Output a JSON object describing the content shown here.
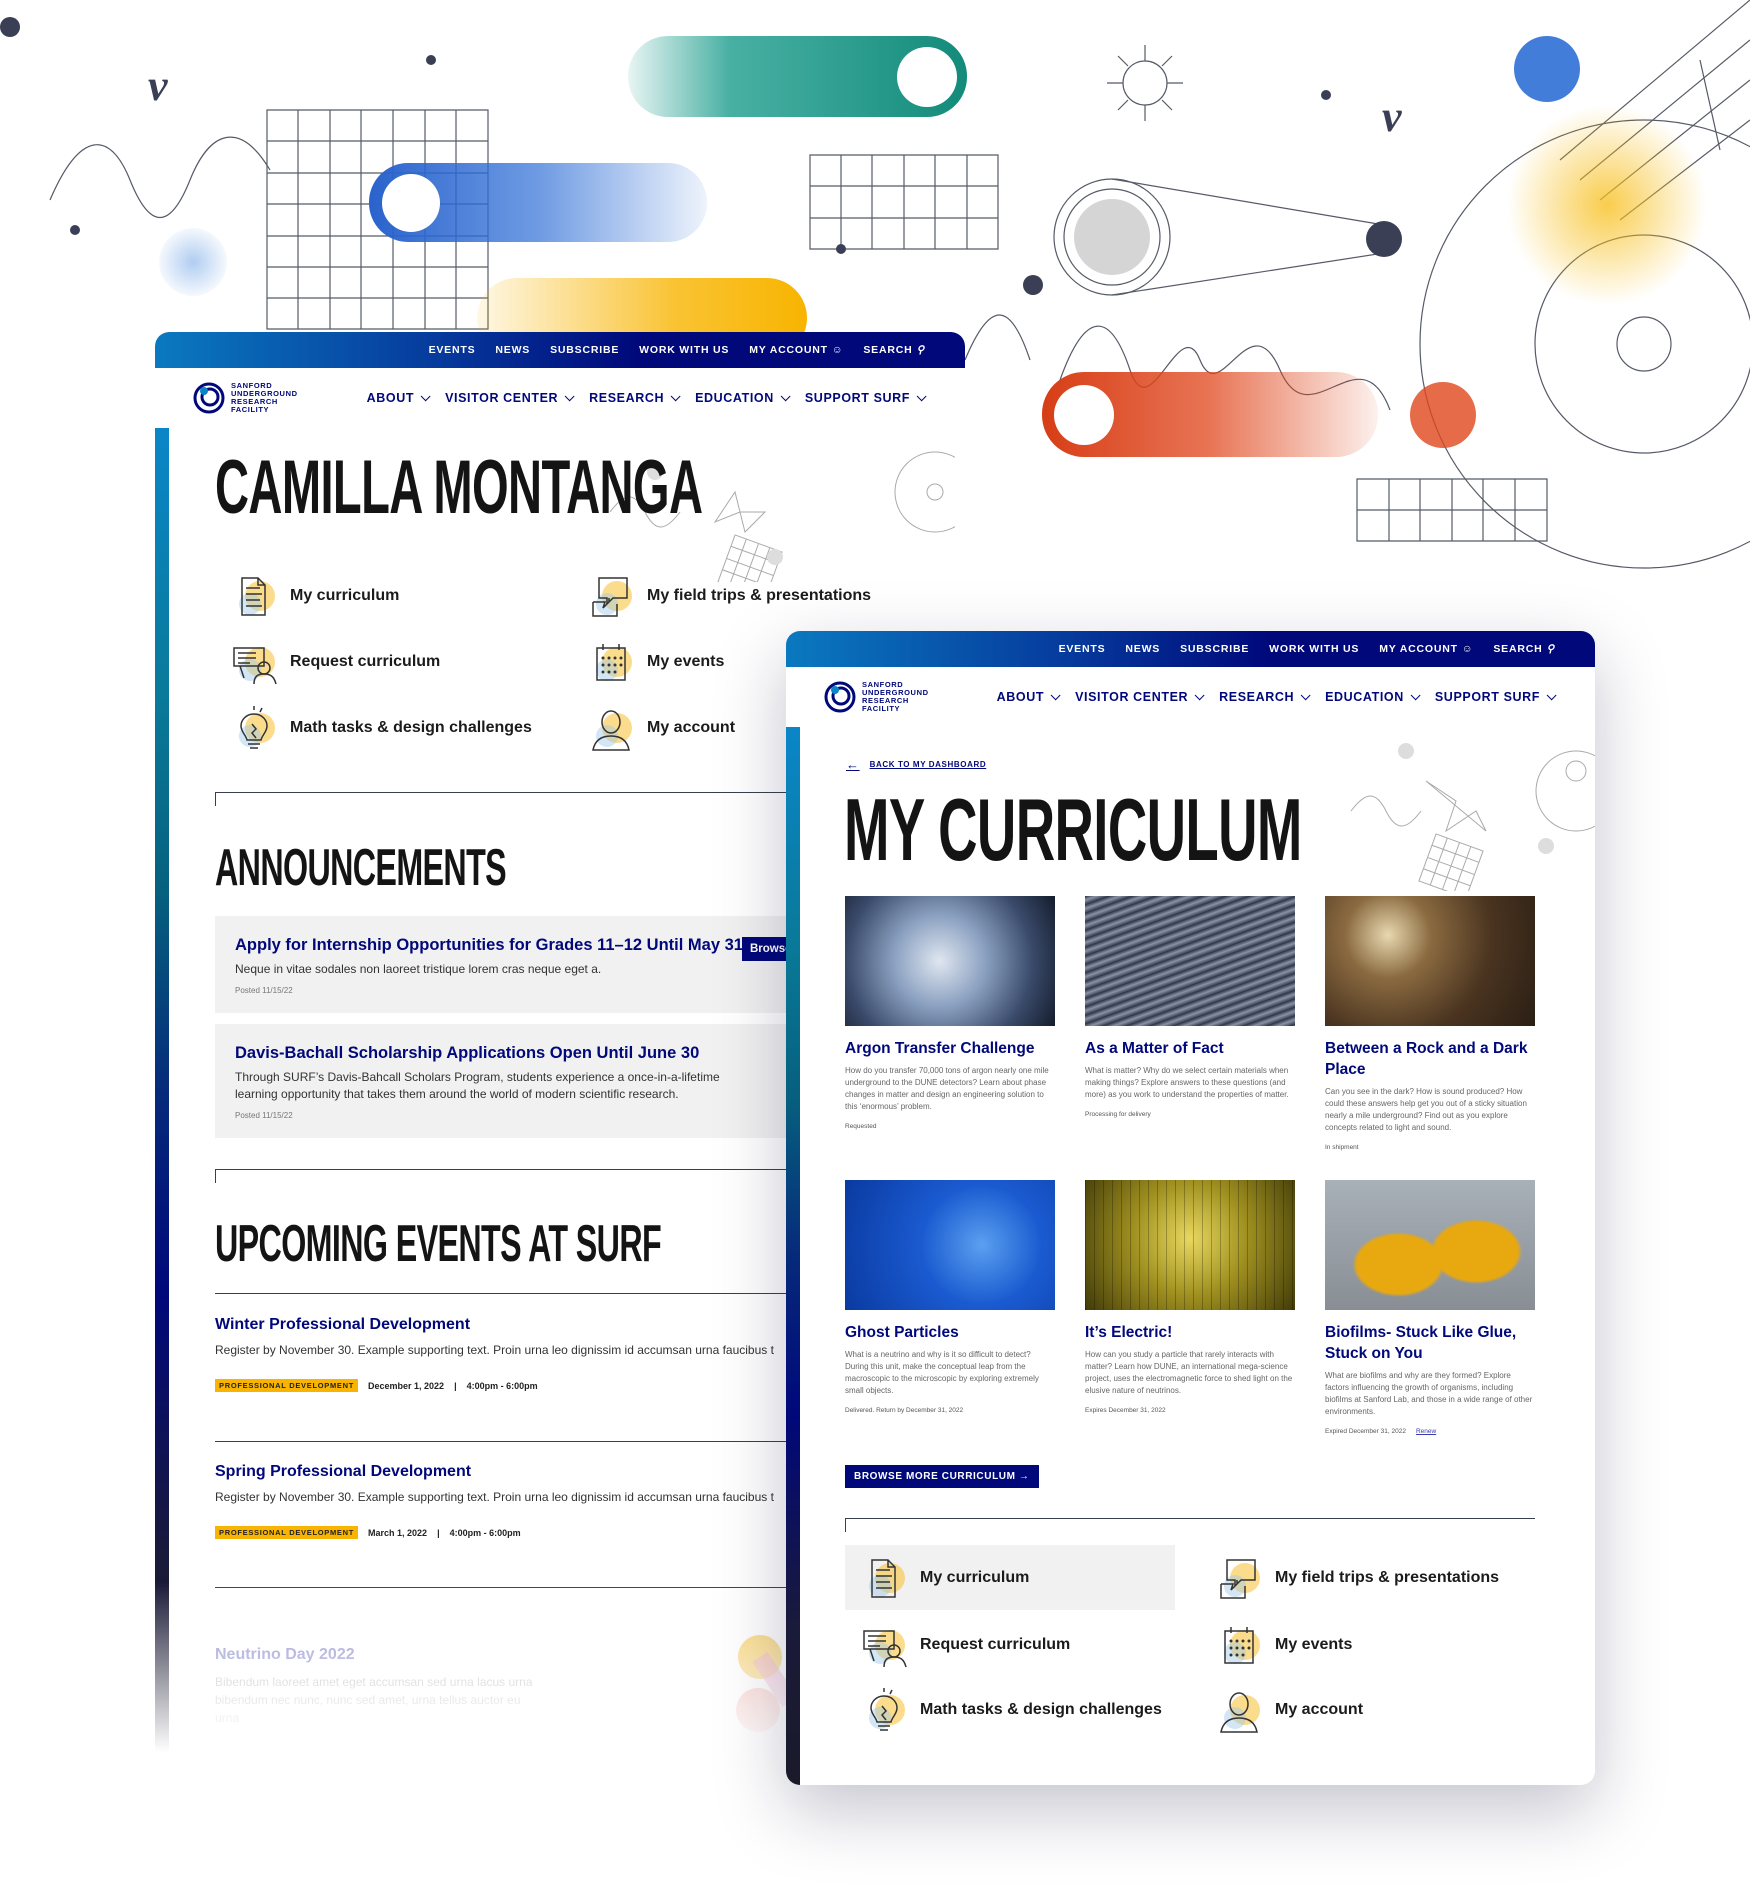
{
  "nav": {
    "utility": [
      "Events",
      "News",
      "Subscribe",
      "Work with us",
      "My account",
      "Search"
    ],
    "main": [
      "About",
      "Visitor Center",
      "Research",
      "Education",
      "Support SURF"
    ],
    "logo": [
      "SANFORD",
      "UNDERGROUND",
      "RESEARCH",
      "FACILITY"
    ]
  },
  "quick_links": [
    {
      "label": "My curriculum",
      "icon": "document"
    },
    {
      "label": "Request curriculum",
      "icon": "presenter"
    },
    {
      "label": "Math tasks & design challenges",
      "icon": "lightbulb"
    },
    {
      "label": "My field trips & presentations",
      "icon": "chat"
    },
    {
      "label": "My events",
      "icon": "calendar"
    },
    {
      "label": "My account",
      "icon": "person"
    }
  ],
  "dashboard": {
    "title": "CAMILLA MONTANGA",
    "announcements_heading": "ANNOUNCEMENTS",
    "announcements": [
      {
        "title": "Apply for Internship Opportunities for Grades 11–12 Until May 31",
        "body": "Neque in vitae sodales non laoreet tristique lorem cras neque eget a.",
        "posted": "Posted 11/15/22",
        "button": "Browse"
      },
      {
        "title": "Davis-Bachall Scholarship Applications Open Until June 30",
        "body": "Through SURF’s Davis-Bahcall Scholars Program, students experience a once-in-a-lifetime learning opportunity that takes them around the world of modern scientific research.",
        "posted": "Posted 11/15/22"
      }
    ],
    "events_heading": "UPCOMING EVENTS AT SURF",
    "events": [
      {
        "title": "Winter Professional Development",
        "body": "Register by November 30. Example supporting text. Proin urna leo dignissim id accumsan urna faucibus t",
        "tag": "PROFESSIONAL DEVELOPMENT",
        "date": "December 1, 2022",
        "time": "4:00pm - 6:00pm"
      },
      {
        "title": "Spring Professional Development",
        "body": "Register by November 30. Example supporting text. Proin urna leo dignissim id accumsan urna faucibus t",
        "tag": "PROFESSIONAL DEVELOPMENT",
        "date": "March 1, 2022",
        "time": "4:00pm - 6:00pm"
      },
      {
        "title": "Neutrino Day 2022",
        "body": "Bibendum laoreet amet eget accumsan sed urna lacus urna bibendum nec nunc, nunc sed amet, urna tellus auctor eu urna"
      }
    ]
  },
  "curriculum": {
    "back_link": "BACK TO MY DASHBOARD",
    "title": "MY CURRICULUM",
    "cards": [
      {
        "title": "Argon Transfer Challenge",
        "body": "How do you transfer 70,000 tons of argon nearly one mile underground to the DUNE detectors? Learn about phase changes in matter and design an engineering solution to this ‘enormous’ problem.",
        "status": "Requested"
      },
      {
        "title": "As a Matter of Fact",
        "body": "What is matter? Why do we select certain materials when making things? Explore answers to these questions (and more) as you work to understand the properties of matter.",
        "status": "Processing for delivery"
      },
      {
        "title": "Between a Rock and a Dark Place",
        "body": "Can you see in the dark? How is sound produced? How could these answers help get you out of a sticky situation nearly a mile underground? Find out as you explore concepts related to light and sound.",
        "status": "In shipment"
      },
      {
        "title": "Ghost Particles",
        "body": "What is a neutrino and why is it so difficult to detect? During this unit, make the conceptual leap from the macroscopic to the microscopic by exploring extremely small objects.",
        "status": "Delivered. Return by December 31, 2022"
      },
      {
        "title": "It’s Electric!",
        "body": "How can you study a particle that rarely interacts with matter? Learn how DUNE, an international mega-science project, uses the electromagnetic force to shed light on the elusive nature of neutrinos.",
        "status": "Expires December 31, 2022"
      },
      {
        "title": "Biofilms- Stuck Like Glue, Stuck on You",
        "body": "What are biofilms and why are they formed? Explore factors influencing the growth of organisms, including biofilms at Sanford Lab, and those in a wide range of other environments.",
        "status": "Expired December 31, 2022",
        "action": "Renew"
      }
    ],
    "browse_button": "BROWSE MORE CURRICULUM"
  },
  "colors": {
    "navy": "#00087a",
    "accent_yellow": "#f8b400",
    "teal": "#1a9c8c",
    "blue": "#2f6fd6",
    "orange": "#e0461c"
  }
}
